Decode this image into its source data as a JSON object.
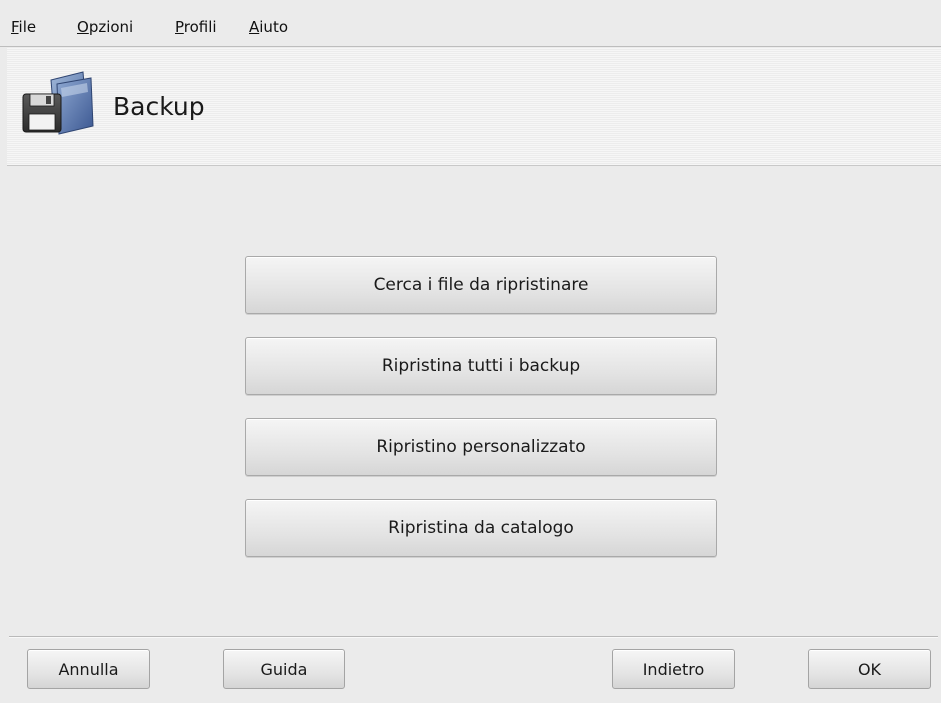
{
  "menubar": {
    "items": [
      {
        "mnemonic": "F",
        "rest": "ile"
      },
      {
        "mnemonic": "O",
        "rest": "pzioni"
      },
      {
        "mnemonic": "P",
        "rest": "rofili"
      },
      {
        "mnemonic": "A",
        "rest": "iuto"
      }
    ]
  },
  "banner": {
    "title": "Backup",
    "icon": "backup-floppy-folder-icon"
  },
  "actions": [
    {
      "label": "Cerca i file da ripristinare"
    },
    {
      "label": "Ripristina tutti i backup"
    },
    {
      "label": "Ripristino personalizzato"
    },
    {
      "label": "Ripristina da catalogo"
    }
  ],
  "footer": {
    "cancel_label": "Annulla",
    "help_label": "Guida",
    "back_label": "Indietro",
    "ok_label": "OK"
  }
}
